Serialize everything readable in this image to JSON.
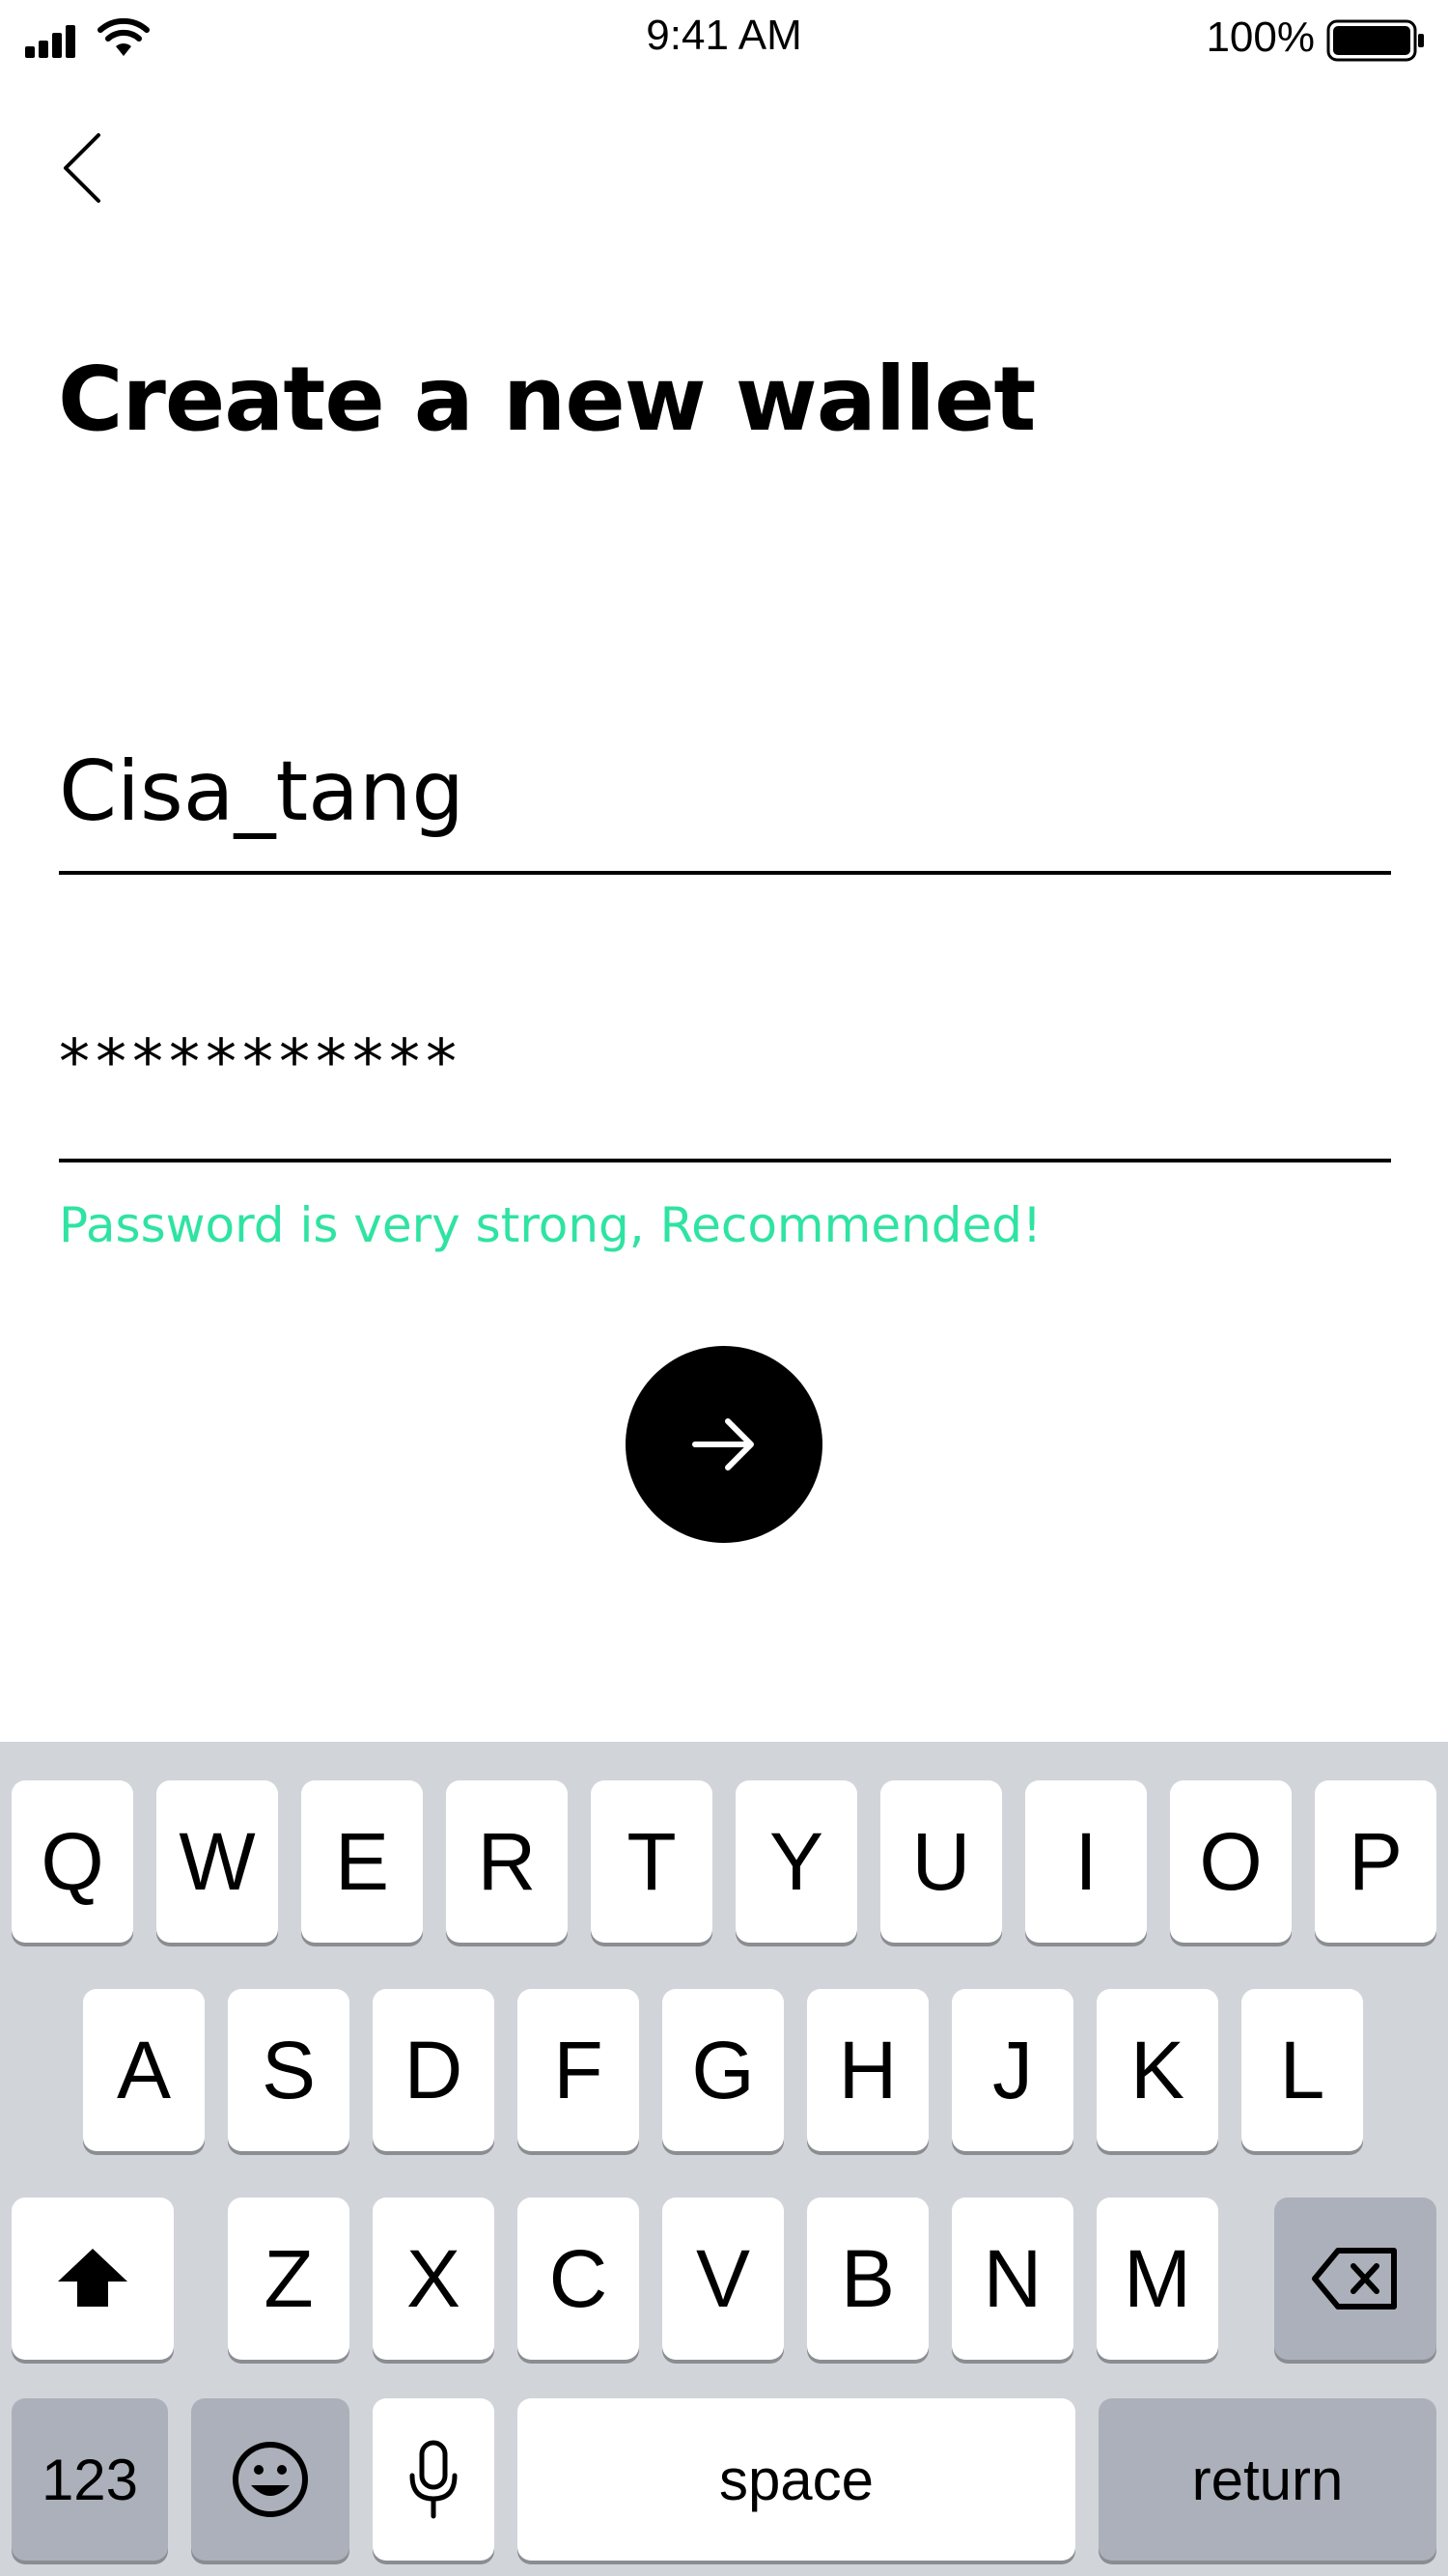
{
  "status_bar": {
    "time": "9:41 AM",
    "battery_percent": "100%"
  },
  "header": {
    "title": "Create a new wallet"
  },
  "form": {
    "wallet_name_value": "Cisa_tang",
    "password_display": "***********",
    "password_hint": "Password is very strong, Recommended!"
  },
  "colors": {
    "hint_green": "#2fe3a2",
    "keyboard_bg": "#d1d4d9",
    "dark_key": "#abb0ba"
  },
  "keyboard": {
    "row1": [
      "Q",
      "W",
      "E",
      "R",
      "T",
      "Y",
      "U",
      "I",
      "O",
      "P"
    ],
    "row2": [
      "A",
      "S",
      "D",
      "F",
      "G",
      "H",
      "J",
      "K",
      "L"
    ],
    "row3": [
      "Z",
      "X",
      "C",
      "V",
      "B",
      "N",
      "M"
    ],
    "numbers_label": "123",
    "space_label": "space",
    "return_label": "return"
  }
}
